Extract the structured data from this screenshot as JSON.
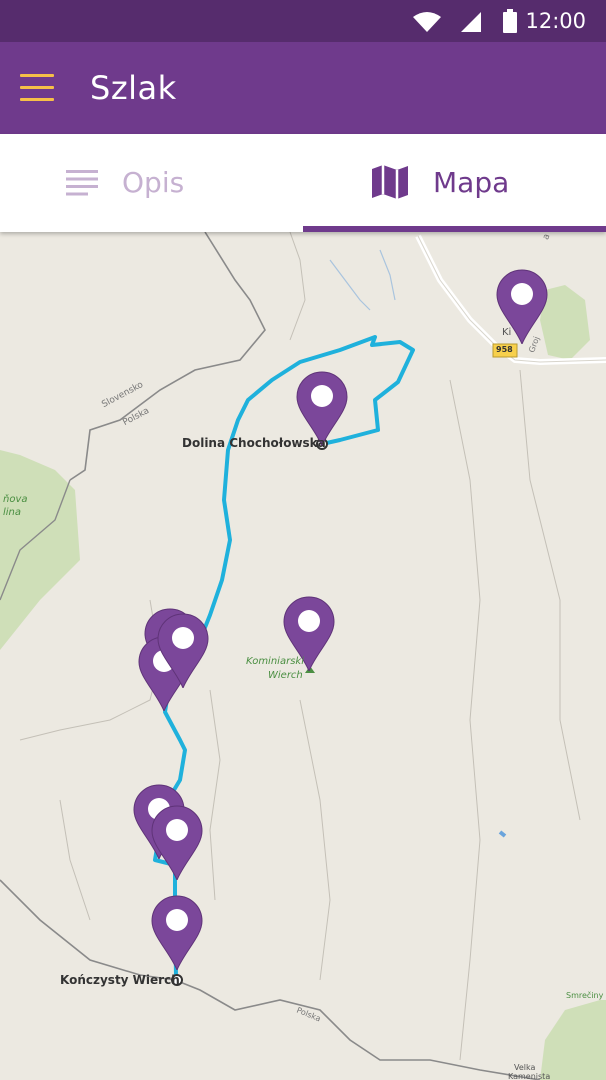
{
  "status_bar": {
    "time": "12:00",
    "icons": [
      "wifi-icon",
      "signal-icon",
      "battery-icon"
    ]
  },
  "app_bar": {
    "title": "Szlak",
    "menu_icon": "menu-icon"
  },
  "tabs": [
    {
      "label": "Opis",
      "icon": "list-icon",
      "selected": false
    },
    {
      "label": "Mapa",
      "icon": "map-icon",
      "selected": true
    }
  ],
  "map": {
    "places": {
      "dolina": "Dolina Chochołowska",
      "konczysty": "Kończysty Wierch",
      "kominiarski_1": "Kominiarski",
      "kominiarski_2": "Wierch",
      "chocholow_2": "lina"
    },
    "borders": {
      "slovensko": "Slovensko",
      "polska_1": "Polska",
      "polska_2": "Polska"
    },
    "road_badge": "958",
    "small_labels": {
      "kir": "Ki",
      "groj": "Groj",
      "smrecin": "Smrečiny",
      "velka_1": "Velka",
      "velka_2": "Kamenista",
      "chocholow_1": "ňova",
      "wa": "a"
    },
    "pin_count": 9
  },
  "colors": {
    "status_bar": "#562c6d",
    "app_bar": "#6f3a8c",
    "accent": "#f6c048",
    "pin": "#7b479a",
    "route": "#1fb1dc",
    "tab_inactive": "#c6b1d1"
  }
}
